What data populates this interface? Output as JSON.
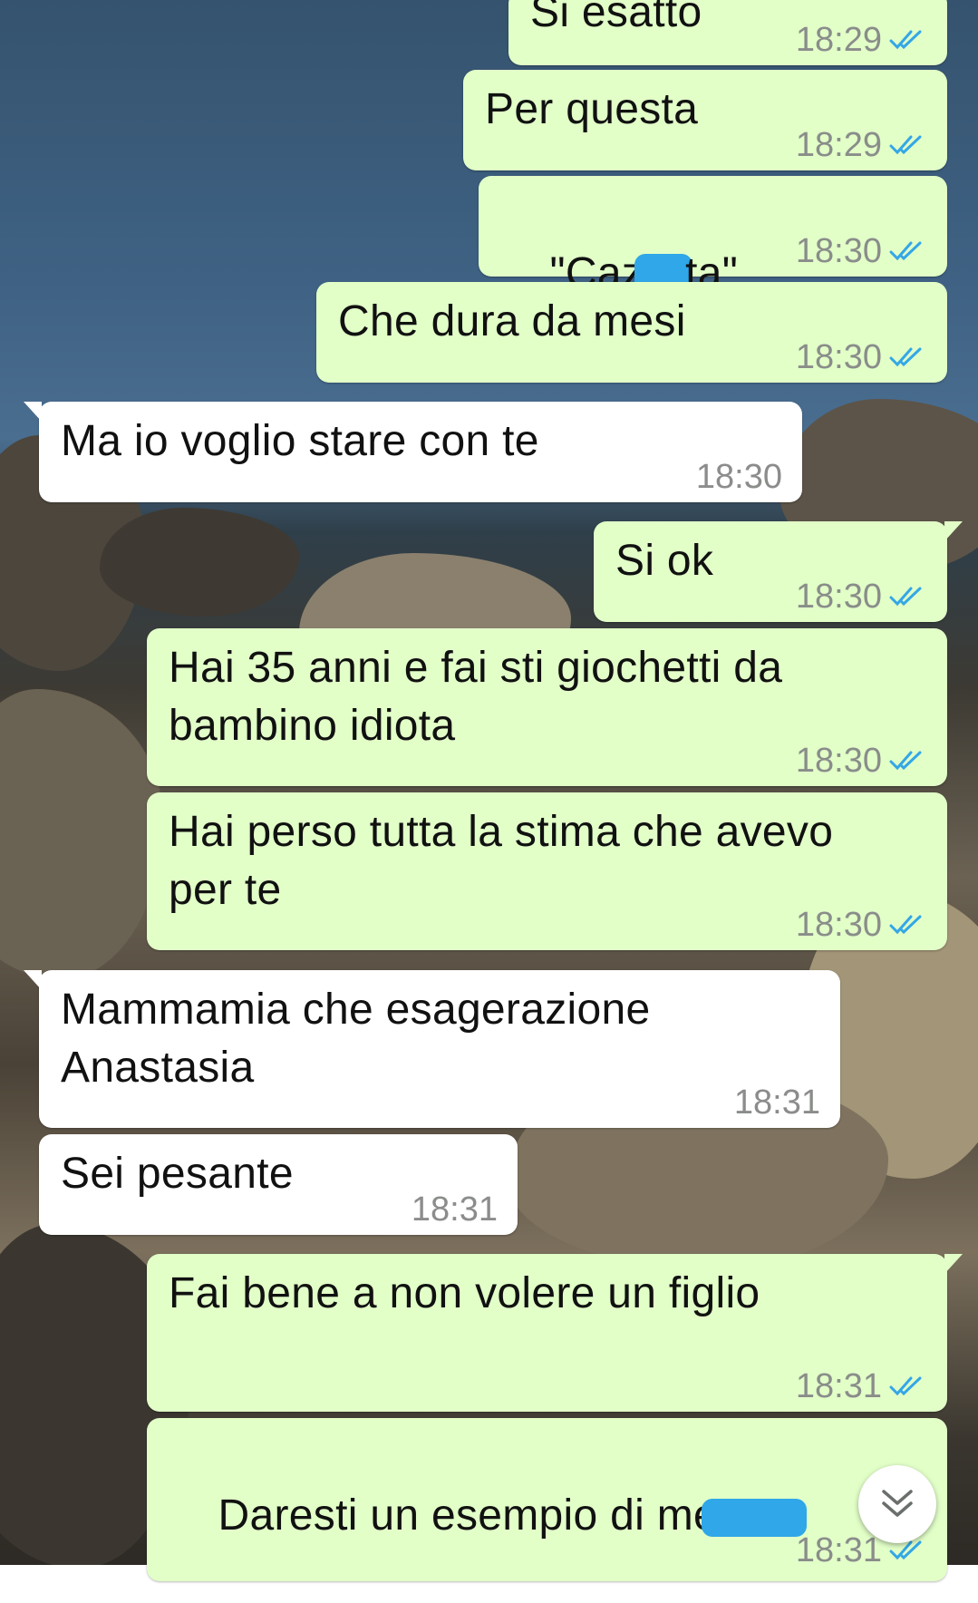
{
  "chat": {
    "messages": [
      {
        "id": "m1",
        "direction": "outgoing",
        "text": "Si esatto",
        "time": "18:29",
        "status": "read"
      },
      {
        "id": "m2",
        "direction": "outgoing",
        "text": "Per questa",
        "time": "18:29",
        "status": "read"
      },
      {
        "id": "m3",
        "direction": "outgoing",
        "text_before": "\"Caz",
        "text_after": "ta\"",
        "time": "18:30",
        "status": "read"
      },
      {
        "id": "m4",
        "direction": "outgoing",
        "text": "Che dura da mesi",
        "time": "18:30",
        "status": "read"
      },
      {
        "id": "m5",
        "direction": "incoming",
        "text": "Ma io voglio stare con te",
        "time": "18:30"
      },
      {
        "id": "m6",
        "direction": "outgoing",
        "text": "Si ok",
        "time": "18:30",
        "status": "read"
      },
      {
        "id": "m7",
        "direction": "outgoing",
        "text": "Hai 35 anni e fai sti giochetti da\nbambino idiota",
        "time": "18:30",
        "status": "read"
      },
      {
        "id": "m8",
        "direction": "outgoing",
        "text": "Hai perso tutta la stima che avevo\nper te",
        "time": "18:30",
        "status": "read"
      },
      {
        "id": "m9",
        "direction": "incoming",
        "text": "Mammamia che esagerazione\nAnastasia",
        "time": "18:31"
      },
      {
        "id": "m10",
        "direction": "incoming",
        "text": "Sei pesante",
        "time": "18:31"
      },
      {
        "id": "m11",
        "direction": "outgoing",
        "text": "Fai bene a non volere un figlio",
        "time": "18:31",
        "status": "read"
      },
      {
        "id": "m12",
        "direction": "outgoing",
        "text_before": "Daresti un esempio di me",
        "time": "18:31",
        "status": "read"
      }
    ],
    "scroll_button": {
      "icon": "double-chevron-down-icon"
    }
  },
  "colors": {
    "outgoing_bubble": "#e2ffc8",
    "incoming_bubble": "#ffffff",
    "read_ticks": "#34a7e6",
    "timestamp": "#8a8d8a",
    "redaction": "#2fa7e8"
  }
}
